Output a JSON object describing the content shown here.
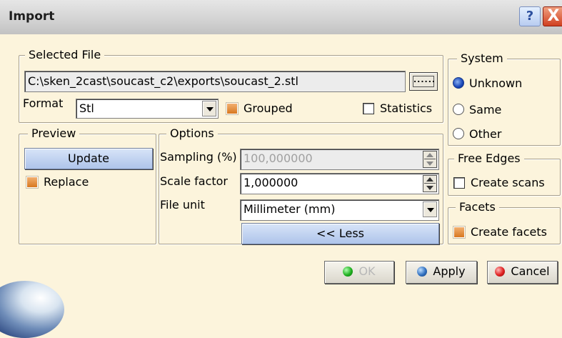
{
  "window": {
    "title": "Import",
    "help_label": "?",
    "close_label": "X"
  },
  "selected_file": {
    "legend": "Selected File",
    "path": "C:\\sken_2cast\\soucast_c2\\exports\\soucast_2.stl",
    "browse_label": "......",
    "format_label": "Format",
    "format_value": "Stl",
    "grouped_label": "Grouped",
    "grouped_checked": true,
    "statistics_label": "Statistics",
    "statistics_checked": false
  },
  "system": {
    "legend": "System",
    "options": [
      "Unknown",
      "Same",
      "Other"
    ],
    "selected": "Unknown"
  },
  "preview": {
    "legend": "Preview",
    "update_label": "Update",
    "replace_label": "Replace",
    "replace_checked": true
  },
  "options": {
    "legend": "Options",
    "sampling_label": "Sampling (%)",
    "sampling_value": "100,000000",
    "scale_label": "Scale factor",
    "scale_value": "1,000000",
    "unit_label": "File unit",
    "unit_value": "Millimeter (mm)",
    "less_label": "<< Less"
  },
  "free_edges": {
    "legend": "Free Edges",
    "create_scans_label": "Create scans",
    "create_scans_checked": false
  },
  "facets": {
    "legend": "Facets",
    "create_facets_label": "Create facets",
    "create_facets_checked": true
  },
  "footer": {
    "ok_label": "OK",
    "apply_label": "Apply",
    "cancel_label": "Cancel"
  },
  "colors": {
    "dialog_bg": "#fcf4dc",
    "title_bg": "#d4d4d4",
    "accent_orange": "#d87820",
    "radio_blue": "#1846b8"
  }
}
